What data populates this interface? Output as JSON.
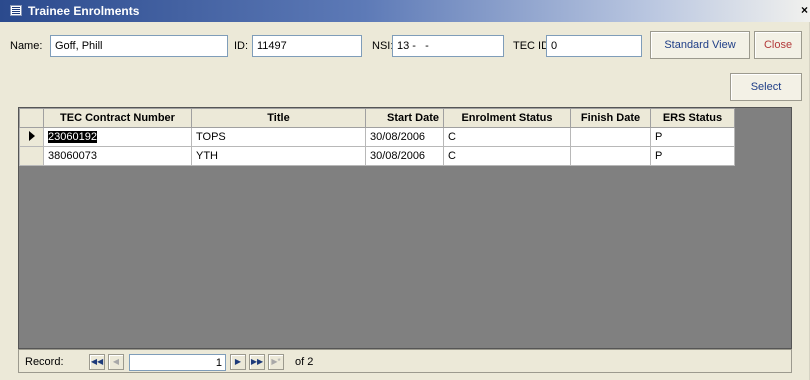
{
  "window": {
    "title": "Trainee Enrolments",
    "close_glyph": "×"
  },
  "form": {
    "name_label": "Name:",
    "name_value": "Goff, Phill",
    "id_label": "ID:",
    "id_value": "11497",
    "nsi_label": "NSI:",
    "nsi_value": "13 -   -",
    "tec_id_label": "TEC ID:",
    "tec_id_value": "0"
  },
  "buttons": {
    "standard_view": "Standard View",
    "close": "Close",
    "select": "Select"
  },
  "grid": {
    "columns": [
      "TEC Contract Number",
      "Title",
      "Start Date",
      "Enrolment Status",
      "Finish Date",
      "ERS Status"
    ],
    "rows": [
      [
        "23060192",
        "TOPS",
        "30/08/2006",
        "C",
        "",
        "P"
      ],
      [
        "38060073",
        "YTH",
        "30/08/2006",
        "C",
        "",
        "P"
      ]
    ],
    "current_row": 0
  },
  "record_nav": {
    "label": "Record:",
    "current": "1",
    "of_text": "of 2",
    "icons": [
      "first-record-icon",
      "previous-record-icon",
      "next-record-icon",
      "last-record-icon",
      "new-record-icon"
    ]
  },
  "colors": {
    "title_bar": "#2b4a8d",
    "grid_background": "#808080",
    "button_text": "#1f3e87",
    "close_text": "#b33a3a"
  }
}
